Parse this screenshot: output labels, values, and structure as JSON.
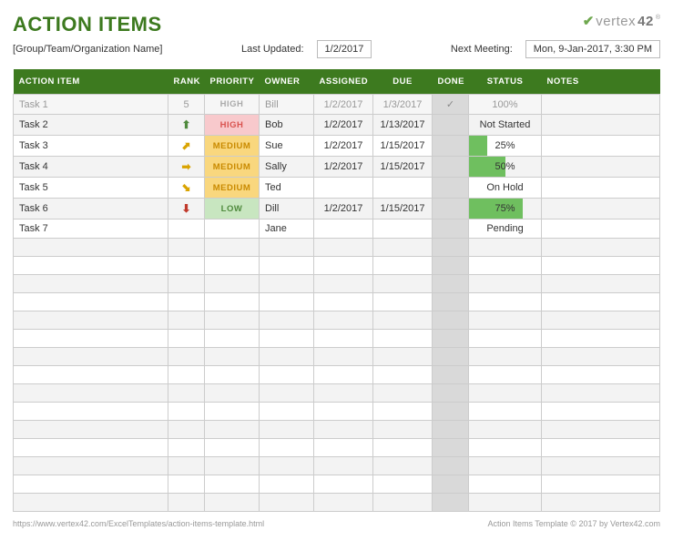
{
  "header": {
    "title": "ACTION ITEMS",
    "logo_text": "vertex",
    "logo_num": "42",
    "team_name": "[Group/Team/Organization Name]",
    "last_updated_label": "Last Updated:",
    "last_updated_value": "1/2/2017",
    "next_meeting_label": "Next Meeting:",
    "next_meeting_value": "Mon, 9-Jan-2017, 3:30 PM"
  },
  "columns": {
    "action_item": "ACTION ITEM",
    "rank": "RANK",
    "priority": "PRIORITY",
    "owner": "OWNER",
    "assigned": "ASSIGNED",
    "due": "DUE",
    "done": "DONE",
    "status": "STATUS",
    "notes": "NOTES"
  },
  "rows": [
    {
      "item": "Task 1",
      "rank": "5",
      "rank_icon": "",
      "rank_color": "",
      "priority": "HIGH",
      "pclass": "completed",
      "owner": "Bill",
      "assigned": "1/2/2017",
      "due": "1/3/2017",
      "done": "✓",
      "status_text": "100%",
      "status_pct": 100,
      "completed": true
    },
    {
      "item": "Task 2",
      "rank": "",
      "rank_icon": "⬆",
      "rank_color": "#4f8a3d",
      "priority": "HIGH",
      "pclass": "high",
      "owner": "Bob",
      "assigned": "1/2/2017",
      "due": "1/13/2017",
      "done": "",
      "status_text": "Not Started",
      "status_pct": 0,
      "completed": false
    },
    {
      "item": "Task 3",
      "rank": "",
      "rank_icon": "⬈",
      "rank_color": "#d9a300",
      "priority": "MEDIUM",
      "pclass": "medium",
      "owner": "Sue",
      "assigned": "1/2/2017",
      "due": "1/15/2017",
      "done": "",
      "status_text": "25%",
      "status_pct": 25,
      "completed": false
    },
    {
      "item": "Task 4",
      "rank": "",
      "rank_icon": "➡",
      "rank_color": "#d9a300",
      "priority": "MEDIUM",
      "pclass": "medium",
      "owner": "Sally",
      "assigned": "1/2/2017",
      "due": "1/15/2017",
      "done": "",
      "status_text": "50%",
      "status_pct": 50,
      "completed": false
    },
    {
      "item": "Task 5",
      "rank": "",
      "rank_icon": "⬊",
      "rank_color": "#d9a300",
      "priority": "MEDIUM",
      "pclass": "medium",
      "owner": "Ted",
      "assigned": "",
      "due": "",
      "done": "",
      "status_text": "On Hold",
      "status_pct": 0,
      "completed": false
    },
    {
      "item": "Task 6",
      "rank": "",
      "rank_icon": "⬇",
      "rank_color": "#c0392b",
      "priority": "LOW",
      "pclass": "low",
      "owner": "Dill",
      "assigned": "1/2/2017",
      "due": "1/15/2017",
      "done": "",
      "status_text": "75%",
      "status_pct": 75,
      "completed": false
    },
    {
      "item": "Task 7",
      "rank": "",
      "rank_icon": "",
      "rank_color": "",
      "priority": "",
      "pclass": "",
      "owner": "Jane",
      "assigned": "",
      "due": "",
      "done": "",
      "status_text": "Pending",
      "status_pct": 0,
      "completed": false
    }
  ],
  "empty_rows": 15,
  "footer": {
    "left": "https://www.vertex42.com/ExcelTemplates/action-items-template.html",
    "right": "Action Items Template © 2017 by Vertex42.com"
  }
}
